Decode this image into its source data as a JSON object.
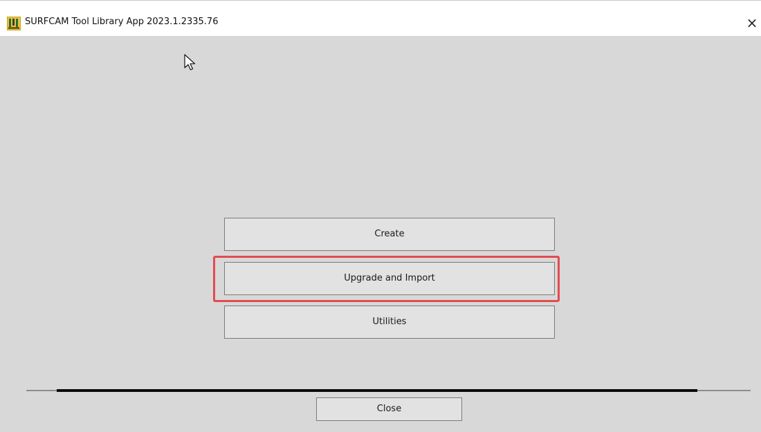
{
  "window": {
    "title": "SURFCAM Tool Library App 2023.1.2335.76",
    "close_glyph": "×",
    "app_icon": "surfcam-app-icon"
  },
  "main": {
    "buttons": [
      {
        "label": "Create"
      },
      {
        "label": "Upgrade and Import"
      },
      {
        "label": "Utilities"
      }
    ],
    "highlighted_button": "Upgrade and Import",
    "highlight_color": "#e34a4f"
  },
  "footer": {
    "close_label": "Close"
  },
  "cursor": "arrow-cursor-icon"
}
